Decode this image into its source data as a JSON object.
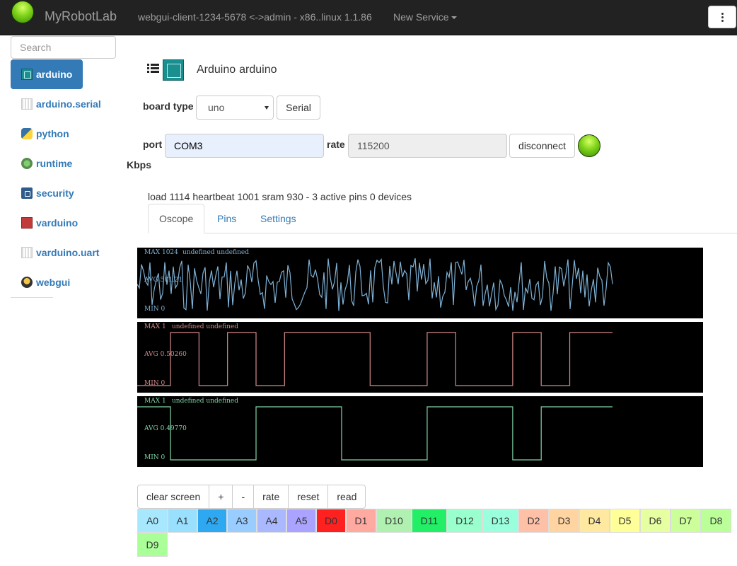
{
  "navbar": {
    "brand": "MyRobotLab",
    "status": "webgui-client-1234-5678 <->admin - x86..linux 1.1.86",
    "new_service": "New Service"
  },
  "sidebar": {
    "search_placeholder": "Search",
    "items": [
      {
        "label": "arduino",
        "icon": "arduino-icon",
        "active": true
      },
      {
        "label": "arduino.serial",
        "icon": "serial-icon"
      },
      {
        "label": "python",
        "icon": "python-icon"
      },
      {
        "label": "runtime",
        "icon": "runtime-icon"
      },
      {
        "label": "security",
        "icon": "security-icon"
      },
      {
        "label": "varduino",
        "icon": "varduino-icon"
      },
      {
        "label": "varduino.uart",
        "icon": "serial-icon"
      },
      {
        "label": "webgui",
        "icon": "webgui-icon"
      }
    ]
  },
  "service": {
    "type": "Arduino",
    "name": "arduino"
  },
  "board": {
    "label": "board type",
    "value": "uno",
    "serial_button": "Serial"
  },
  "connection": {
    "port_label": "port",
    "port_value": "COM3",
    "rate_label": "rate",
    "rate_value": "115200",
    "disconnect_button": "disconnect",
    "kbps_label": "Kbps",
    "led_color": "#7fd31a"
  },
  "status_line": "load 1114 heartbeat 1001 sram 930 - 3 active pins 0 devices",
  "tabs": [
    {
      "label": "Oscope",
      "active": true
    },
    {
      "label": "Pins"
    },
    {
      "label": "Settings"
    }
  ],
  "oscope": [
    {
      "max": "MAX 1024",
      "extra": "undefined undefined",
      "avg": "AVG 501.21",
      "min": "MIN 0",
      "color": "#7fb2d6",
      "type": "analog"
    },
    {
      "max": "MAX 1",
      "extra": "undefined undefined",
      "avg": "AVG 0.50260",
      "min": "MIN 0",
      "color": "#d58a8a",
      "type": "digital",
      "transitions": [
        0.0,
        0.07,
        0.13,
        0.19,
        0.25,
        0.31,
        0.49,
        0.61,
        0.67,
        0.79,
        0.85,
        0.91,
        1.0
      ],
      "start": 0
    },
    {
      "max": "MAX 1",
      "extra": "undefined undefined",
      "avg": "AVG 0.49770",
      "min": "MIN 0",
      "color": "#7fd6a6",
      "type": "digital",
      "transitions": [
        0.0,
        0.07,
        0.25,
        0.43,
        0.61,
        0.79,
        0.85,
        1.0
      ],
      "start": 1
    }
  ],
  "controls": [
    "clear screen",
    "+",
    "-",
    "rate",
    "reset",
    "read"
  ],
  "pins": [
    {
      "label": "A0",
      "color": "#a8e8ff"
    },
    {
      "label": "A1",
      "color": "#99e0ff"
    },
    {
      "label": "A2",
      "color": "#2ea8f0"
    },
    {
      "label": "A3",
      "color": "#99ccff"
    },
    {
      "label": "A4",
      "color": "#aab8ff"
    },
    {
      "label": "A5",
      "color": "#aaa3ff"
    },
    {
      "label": "D0",
      "color": "#ff2020"
    },
    {
      "label": "D1",
      "color": "#ffaaa0"
    },
    {
      "label": "D10",
      "color": "#b0f0b0"
    },
    {
      "label": "D11",
      "color": "#22ee66"
    },
    {
      "label": "D12",
      "color": "#99ffcc"
    },
    {
      "label": "D13",
      "color": "#99ffdd"
    },
    {
      "label": "D2",
      "color": "#ffc0a8"
    },
    {
      "label": "D3",
      "color": "#ffd4a0"
    },
    {
      "label": "D4",
      "color": "#ffe8a0"
    },
    {
      "label": "D5",
      "color": "#ffff99"
    },
    {
      "label": "D6",
      "color": "#e6ffa0"
    },
    {
      "label": "D7",
      "color": "#ccff99"
    },
    {
      "label": "D8",
      "color": "#bbff99"
    },
    {
      "label": "D9",
      "color": "#aaff99"
    }
  ]
}
